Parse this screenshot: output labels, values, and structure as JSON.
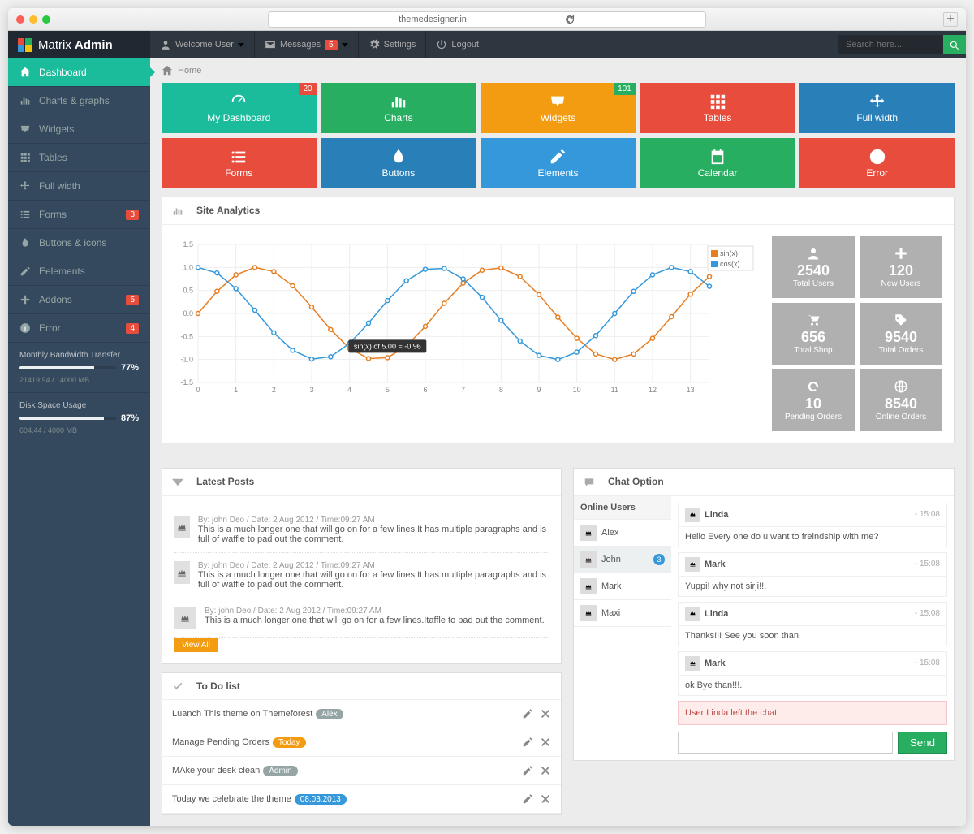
{
  "browser": {
    "url": "themedesigner.in",
    "plus": "+"
  },
  "brand": {
    "a": "Matrix ",
    "b": "Admin"
  },
  "topnav": {
    "welcome": "Welcome User",
    "messages": "Messages",
    "messages_badge": "5",
    "settings": "Settings",
    "logout": "Logout",
    "search_placeholder": "Search here..."
  },
  "sidebar": {
    "items": [
      {
        "label": "Dashboard",
        "active": true
      },
      {
        "label": "Charts & graphs"
      },
      {
        "label": "Widgets"
      },
      {
        "label": "Tables"
      },
      {
        "label": "Full width"
      },
      {
        "label": "Forms",
        "badge": "3"
      },
      {
        "label": "Buttons & icons"
      },
      {
        "label": "Eelements"
      },
      {
        "label": "Addons",
        "badge": "5"
      },
      {
        "label": "Error",
        "badge": "4"
      }
    ],
    "bw": {
      "title": "Monthly Bandwidth Transfer",
      "pct": "77%",
      "pct_num": 77,
      "sub": "21419.94 / 14000 MB"
    },
    "disk": {
      "title": "Disk Space Usage",
      "pct": "87%",
      "pct_num": 87,
      "sub": "604.44 / 4000 MB"
    }
  },
  "breadcrumb": {
    "home": "Home"
  },
  "tiles_row1": [
    {
      "label": "My Dashboard",
      "color": "t-blue",
      "icon": "dashboard",
      "badge": "20",
      "badge_color": ""
    },
    {
      "label": "Charts",
      "color": "t-green",
      "icon": "bars"
    },
    {
      "label": "Widgets",
      "color": "t-orange",
      "icon": "inbox",
      "badge": "101",
      "badge_color": "green"
    },
    {
      "label": "Tables",
      "color": "t-red",
      "icon": "grid"
    },
    {
      "label": "Full width",
      "color": "t-dblue",
      "icon": "arrows"
    }
  ],
  "tiles_row2": [
    {
      "label": "Forms",
      "color": "t-red",
      "icon": "list"
    },
    {
      "label": "Buttons",
      "color": "t-dblue",
      "icon": "drop"
    },
    {
      "label": "Elements",
      "color": "t-sky",
      "icon": "pencil"
    },
    {
      "label": "Calendar",
      "color": "t-green",
      "icon": "calendar"
    },
    {
      "label": "Error",
      "color": "t-red",
      "icon": "info"
    }
  ],
  "analytics": {
    "title": "Site Analytics",
    "tooltip": "sin(x) of 5.00 = -0.96"
  },
  "chart_data": {
    "type": "line",
    "xlabel": "",
    "ylabel": "",
    "xlim": [
      0,
      13.5
    ],
    "ylim": [
      -1.5,
      1.5
    ],
    "x": [
      0,
      0.5,
      1,
      1.5,
      2,
      2.5,
      3,
      3.5,
      4,
      4.5,
      5,
      5.5,
      6,
      6.5,
      7,
      7.5,
      8,
      8.5,
      9,
      9.5,
      10,
      10.5,
      11,
      11.5,
      12,
      12.5,
      13,
      13.5
    ],
    "series": [
      {
        "name": "sin(x)",
        "color": "#e67e22",
        "values": [
          0,
          0.48,
          0.84,
          1.0,
          0.91,
          0.6,
          0.14,
          -0.35,
          -0.76,
          -0.98,
          -0.96,
          -0.71,
          -0.28,
          0.22,
          0.66,
          0.94,
          0.99,
          0.8,
          0.41,
          -0.08,
          -0.54,
          -0.88,
          -1.0,
          -0.88,
          -0.54,
          -0.07,
          0.42,
          0.8
        ]
      },
      {
        "name": "cos(x)",
        "color": "#3498db",
        "values": [
          1,
          0.88,
          0.54,
          0.07,
          -0.42,
          -0.8,
          -0.99,
          -0.94,
          -0.65,
          -0.21,
          0.28,
          0.71,
          0.96,
          0.98,
          0.75,
          0.35,
          -0.15,
          -0.6,
          -0.91,
          -1.0,
          -0.84,
          -0.48,
          0.0,
          0.48,
          0.84,
          1.0,
          0.91,
          0.59
        ]
      }
    ],
    "legend": [
      "sin(x)",
      "cos(x)"
    ]
  },
  "stats": [
    {
      "num": "2540",
      "label": "Total Users",
      "icon": "user"
    },
    {
      "num": "120",
      "label": "New Users",
      "icon": "plus"
    },
    {
      "num": "656",
      "label": "Total Shop",
      "icon": "cart"
    },
    {
      "num": "9540",
      "label": "Total Orders",
      "icon": "tag"
    },
    {
      "num": "10",
      "label": "Pending Orders",
      "icon": "refresh"
    },
    {
      "num": "8540",
      "label": "Online Orders",
      "icon": "globe"
    }
  ],
  "posts": {
    "title": "Latest Posts",
    "items": [
      {
        "meta": "By: john Deo / Date: 2 Aug 2012 / Time:09:27 AM",
        "text": "This is a much longer one that will go on for a few lines.It has multiple paragraphs and is full of waffle to pad out the comment."
      },
      {
        "meta": "By: john Deo / Date: 2 Aug 2012 / Time:09:27 AM",
        "text": "This is a much longer one that will go on for a few lines.It has multiple paragraphs and is full of waffle to pad out the comment."
      },
      {
        "meta": "By: john Deo / Date: 2 Aug 2012 / Time:09:27 AM",
        "text": "This is a much longer one that will go on for a few lines.Itaffle to pad out the comment."
      }
    ],
    "view_all": "View All"
  },
  "todo": {
    "title": "To Do list",
    "items": [
      {
        "text": "Luanch This theme on Themeforest",
        "tag": "Alex",
        "tag_color": "#95a5a6"
      },
      {
        "text": "Manage Pending Orders",
        "tag": "Today",
        "tag_color": "#f39c12"
      },
      {
        "text": "MAke your desk clean",
        "tag": "Admin",
        "tag_color": "#95a5a6"
      },
      {
        "text": "Today we celebrate the theme",
        "tag": "08.03.2013",
        "tag_color": "#3498db"
      }
    ]
  },
  "chat": {
    "title": "Chat Option",
    "online_hd": "Online Users",
    "users": [
      {
        "name": "Alex"
      },
      {
        "name": "John",
        "badge": "3",
        "selected": true
      },
      {
        "name": "Mark"
      },
      {
        "name": "Maxi"
      }
    ],
    "messages": [
      {
        "name": "Linda",
        "time": "- 15:08",
        "text": "Hello Every one do u want to freindship with me?"
      },
      {
        "name": "Mark",
        "time": "- 15:08",
        "text": "Yuppi! why not sirji!!."
      },
      {
        "name": "Linda",
        "time": "- 15:08",
        "text": "Thanks!!! See you soon than"
      },
      {
        "name": "Mark",
        "time": "- 15:08",
        "text": "ok Bye than!!!."
      }
    ],
    "notice": "User Linda left the chat",
    "send": "Send"
  }
}
